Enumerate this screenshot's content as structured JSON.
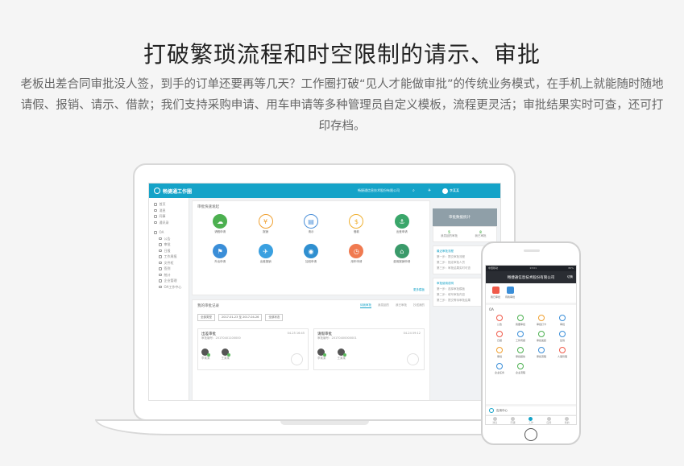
{
  "headline": "打破繁琐流程和时空限制的请示、审批",
  "description": "老板出差合同审批没人签，到手的订单还要再等几天？工作圈打破“见人才能做审批”的传统业务模式，在手机上就能随时随地请假、报销、请示、借款；我们支持采购申请、用车申请等多种管理员自定义模板，流程更灵活；审批结果实时可查，还可打印存档。",
  "desktop_app": {
    "logo": "畅捷通工作圈",
    "company": "畅捷通信息技术股份有限公司",
    "user": "李某某",
    "sidebar": {
      "nav": [
        "首页",
        "消息",
        "同事",
        "通讯录"
      ],
      "group": "OA",
      "items": [
        "公告",
        "审批",
        "日报",
        "工作周报",
        "文件柜",
        "签到",
        "统计",
        "企业管理",
        "OA工作中心"
      ]
    },
    "quick_start": {
      "title": "审批快速发起",
      "items": [
        "请假申请",
        "报销",
        "请示",
        "借款",
        "出差申请",
        "外出申请",
        "出差报销",
        "加班申请",
        "用车申请",
        "费用报销申请"
      ],
      "more": "更多模板"
    },
    "records": {
      "title": "我的审批记录",
      "tabs": [
        "待我审批",
        "我发起的",
        "我已审批",
        "抄送我的"
      ],
      "filters": [
        "全部类型",
        "2017-01-23 至 2017-04-26",
        "全部状态"
      ],
      "cards": [
        {
          "title": "出差审批",
          "meta": "审批编号：20170401100000",
          "date": "04-25 16:45",
          "steps": [
            "李某某",
            "王某某"
          ]
        },
        {
          "title": "请假审批",
          "meta": "审批编号：20170400000001",
          "date": "04-24 09:12",
          "steps": [
            "李某某",
            "王某某"
          ]
        }
      ]
    },
    "right": {
      "banner": "审批数据统计",
      "stats": [
        {
          "value": "5",
          "label": "我发起的审批"
        },
        {
          "value": "8",
          "label": "我已审批"
        }
      ],
      "block1_title": "最近审批流程",
      "block1_lines": [
        "第一步：提交审批流程",
        "第二步：指定审批人员",
        "第三步：审批结果实时可查"
      ],
      "block2_title": "审批使用说明",
      "block2_lines": [
        "第一步：选择审批模板",
        "第二步：填写审批内容",
        "第三步：提交等待审批结果"
      ]
    }
  },
  "mobile_app": {
    "status_left": "中国移动",
    "time": "13:01",
    "status_right": "80%",
    "header": "畅捷通信息技术股份有限公司",
    "header_toggle": "切换",
    "top_items": [
      "我已审批",
      "待我审批"
    ],
    "oa_label": "OA",
    "grid": [
      "公告",
      "我要审批",
      "审批打卡",
      "审批",
      "日报",
      "工作周报",
      "审批发起",
      "签到",
      "审批",
      "审批报告",
      "审批流程",
      "人事管理",
      "企业任务",
      "企业流程"
    ],
    "app_section": "应用中心",
    "tabs": [
      "消息",
      "同事",
      "工作",
      "应用",
      "我的"
    ],
    "accent": "#15a3c8"
  }
}
